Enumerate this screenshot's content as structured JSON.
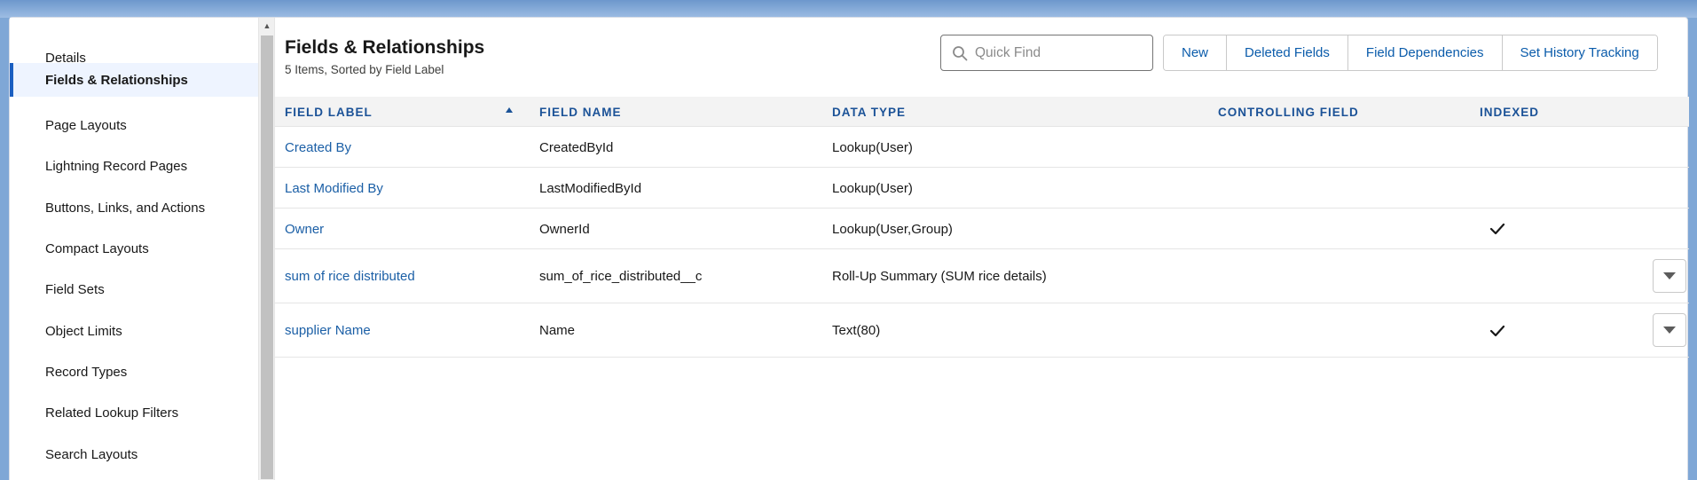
{
  "sidebar": {
    "items": [
      {
        "label": "Details",
        "active": false
      },
      {
        "label": "Fields & Relationships",
        "active": true
      },
      {
        "label": "Page Layouts",
        "active": false
      },
      {
        "label": "Lightning Record Pages",
        "active": false
      },
      {
        "label": "Buttons, Links, and Actions",
        "active": false
      },
      {
        "label": "Compact Layouts",
        "active": false
      },
      {
        "label": "Field Sets",
        "active": false
      },
      {
        "label": "Object Limits",
        "active": false
      },
      {
        "label": "Record Types",
        "active": false
      },
      {
        "label": "Related Lookup Filters",
        "active": false
      },
      {
        "label": "Search Layouts",
        "active": false
      }
    ]
  },
  "header": {
    "title": "Fields & Relationships",
    "subtitle": "5 Items, Sorted by Field Label"
  },
  "search": {
    "placeholder": "Quick Find",
    "value": ""
  },
  "toolbar": {
    "new_label": "New",
    "deleted_fields_label": "Deleted Fields",
    "field_dependencies_label": "Field Dependencies",
    "set_history_tracking_label": "Set History Tracking"
  },
  "table": {
    "columns": {
      "field_label": "FIELD LABEL",
      "field_name": "FIELD NAME",
      "data_type": "DATA TYPE",
      "controlling_field": "CONTROLLING FIELD",
      "indexed": "INDEXED"
    },
    "sort_column": "FIELD LABEL",
    "sort_direction": "ascending",
    "rows": [
      {
        "field_label": "Created By",
        "field_name": "CreatedById",
        "data_type": "Lookup(User)",
        "controlling_field": "",
        "indexed": false,
        "has_action": false
      },
      {
        "field_label": "Last Modified By",
        "field_name": "LastModifiedById",
        "data_type": "Lookup(User)",
        "controlling_field": "",
        "indexed": false,
        "has_action": false
      },
      {
        "field_label": "Owner",
        "field_name": "OwnerId",
        "data_type": "Lookup(User,Group)",
        "controlling_field": "",
        "indexed": true,
        "has_action": false
      },
      {
        "field_label": "sum of rice distributed",
        "field_name": "sum_of_rice_distributed__c",
        "data_type": "Roll-Up Summary (SUM rice details)",
        "controlling_field": "",
        "indexed": false,
        "has_action": true
      },
      {
        "field_label": "supplier Name",
        "field_name": "Name",
        "data_type": "Text(80)",
        "controlling_field": "",
        "indexed": true,
        "has_action": true
      }
    ]
  },
  "colors": {
    "accent": "#1b5fc1",
    "link": "#1b5fa6",
    "header_text": "#1b5297"
  },
  "icons": {
    "search": "search-icon",
    "check": "check-icon",
    "row_action": "chevron-down-icon",
    "sort": "sort-ascending-icon"
  }
}
